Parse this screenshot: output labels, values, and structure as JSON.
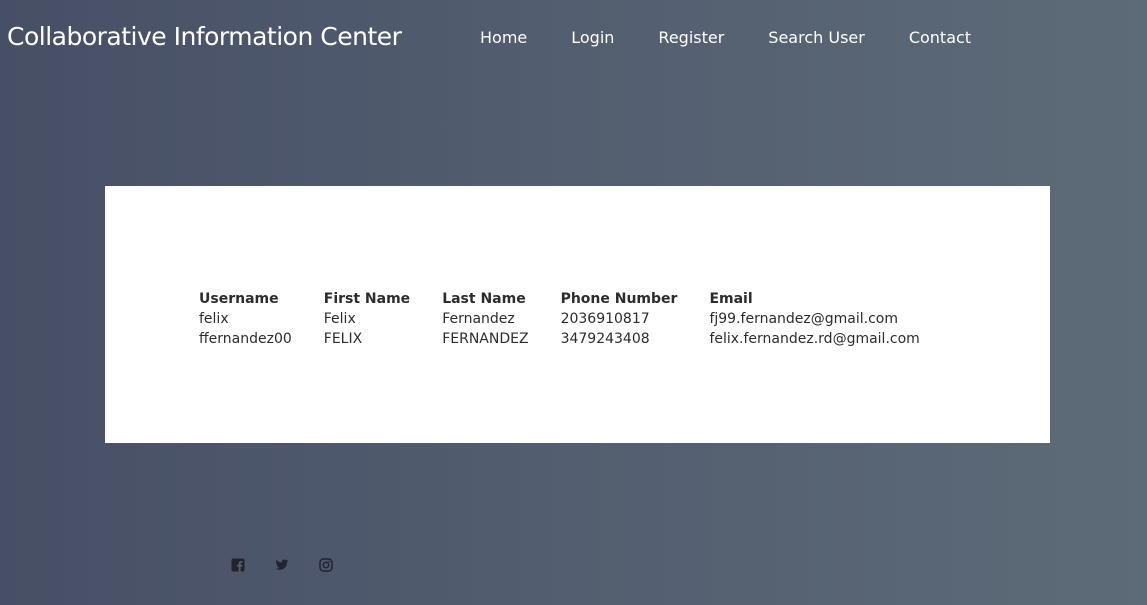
{
  "header": {
    "title": "Collaborative Information Center"
  },
  "nav": {
    "items": [
      {
        "label": "Home"
      },
      {
        "label": "Login"
      },
      {
        "label": "Register"
      },
      {
        "label": "Search User"
      },
      {
        "label": "Contact"
      }
    ]
  },
  "table": {
    "columns": [
      "Username",
      "First Name",
      "Last Name",
      "Phone Number",
      "Email"
    ],
    "rows": [
      [
        "felix",
        "Felix",
        "Fernandez",
        "2036910817",
        "fj99.fernandez@gmail.com"
      ],
      [
        "ffernandez00",
        "FELIX",
        "FERNANDEZ",
        "3479243408",
        "felix.fernandez.rd@gmail.com"
      ]
    ]
  },
  "footer": {
    "social_icons": [
      "facebook-icon",
      "twitter-icon",
      "instagram-icon"
    ]
  },
  "colors": {
    "background_start": "#474f66",
    "background_end": "#5d6b78",
    "panel": "#ffffff",
    "text": "#2c2c2c"
  }
}
